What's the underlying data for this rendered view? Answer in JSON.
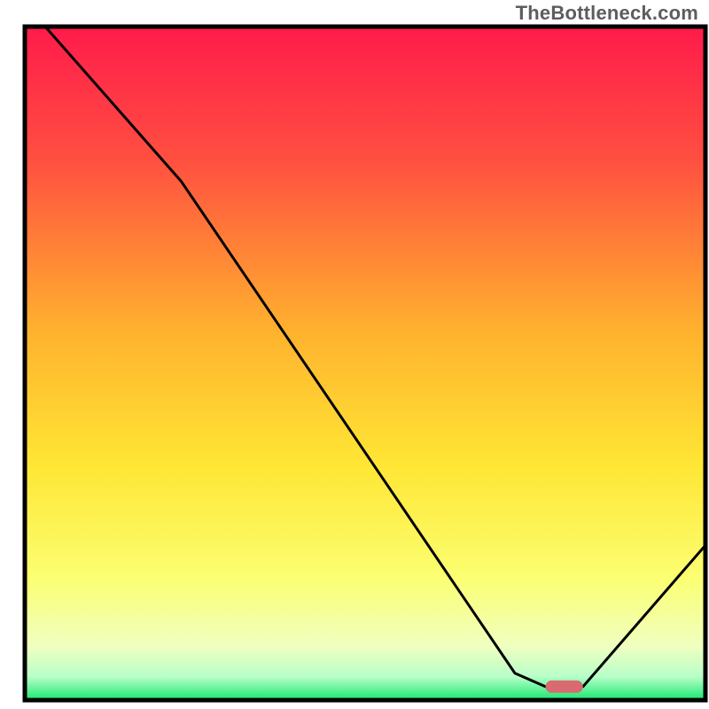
{
  "watermark": "TheBottleneck.com",
  "chart_data": {
    "type": "line",
    "title": "",
    "xlabel": "",
    "ylabel": "",
    "xlim": [
      0,
      100
    ],
    "ylim": [
      0,
      100
    ],
    "grid": false,
    "legend": false,
    "series": [
      {
        "name": "curve",
        "x": [
          3,
          23,
          72,
          76.5,
          82,
          100
        ],
        "y": [
          100,
          77,
          4,
          2,
          2,
          23
        ]
      }
    ],
    "marker": {
      "name": "optimal-region",
      "x_range": [
        76.5,
        82
      ],
      "y": 2,
      "color": "#d96a6f"
    },
    "gradient_stops": [
      {
        "pos": 0.0,
        "color": "#ff1b4b"
      },
      {
        "pos": 0.2,
        "color": "#ff5040"
      },
      {
        "pos": 0.45,
        "color": "#ffb12e"
      },
      {
        "pos": 0.65,
        "color": "#ffe634"
      },
      {
        "pos": 0.82,
        "color": "#fbff72"
      },
      {
        "pos": 0.92,
        "color": "#f0ffc0"
      },
      {
        "pos": 0.965,
        "color": "#b8ffc8"
      },
      {
        "pos": 1.0,
        "color": "#17e86f"
      }
    ],
    "frame_color": "#000000",
    "curve_color": "#000000",
    "curve_width": 3
  }
}
